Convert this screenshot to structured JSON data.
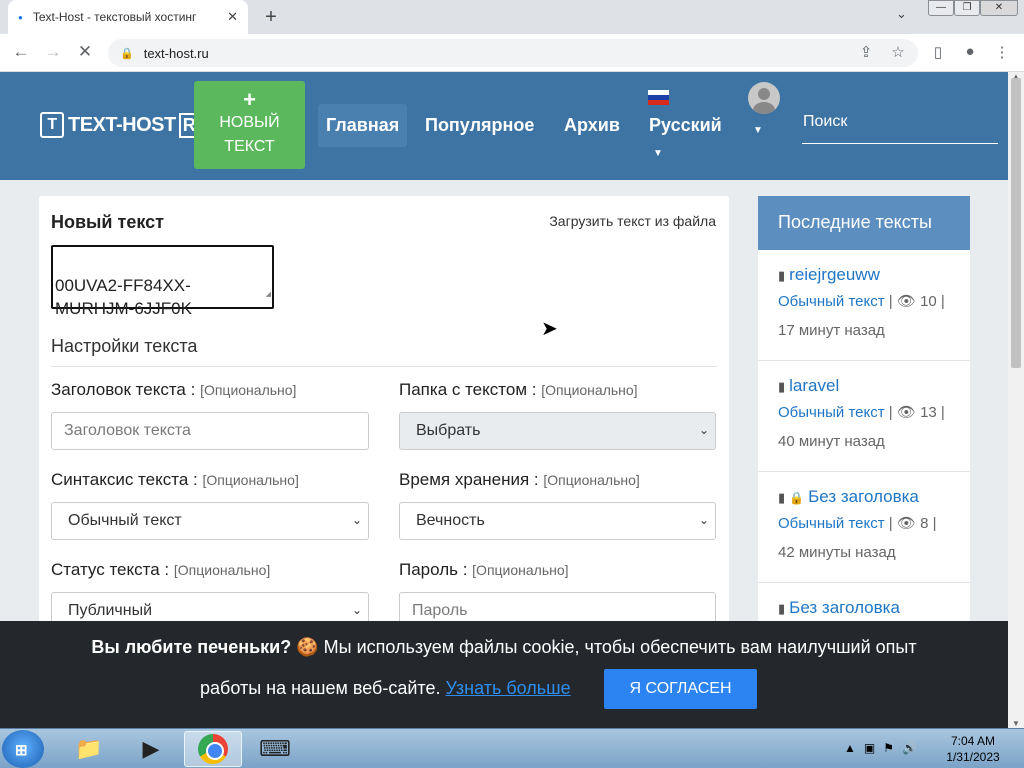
{
  "browser": {
    "tab_title": "Text-Host - текстовый хостинг",
    "tab_close": "✕",
    "new_tab": "+",
    "tab_menu": "⌄",
    "url": "text-host.ru",
    "window_controls": [
      "—",
      "❐",
      "✕"
    ]
  },
  "site": {
    "logo_mark": "T",
    "logo_text": "TEXT-HOST",
    "logo_ru": "RU",
    "new_text_plus": "+",
    "new_text_line1": "НОВЫЙ",
    "new_text_line2": "ТЕКСТ",
    "nav": [
      "Главная",
      "Популярное",
      "Архив",
      "Русский"
    ],
    "search_placeholder": "Поиск"
  },
  "form": {
    "title": "Новый текст",
    "upload_link": "Загрузить текст из файла",
    "text_value": "00UVA2-FF84XX-\nMURHJM-6JJF0K",
    "settings_title": "Настройки текста",
    "optional": "[Опционально]",
    "fields": {
      "title_label": "Заголовок текста :",
      "title_placeholder": "Заголовок текста",
      "folder_label": "Папка с текстом :",
      "folder_value": "Выбрать",
      "syntax_label": "Синтаксис текста :",
      "syntax_value": "Обычный текст",
      "expire_label": "Время хранения :",
      "expire_value": "Вечность",
      "status_label": "Статус текста :",
      "status_value": "Публичный",
      "password_label": "Пароль :",
      "password_placeholder": "Пароль"
    }
  },
  "sidebar": {
    "title": "Последние тексты",
    "items": [
      {
        "title": "reiejrgeuww",
        "type": "Обычный текст",
        "views": "10",
        "time": "17 минут назад",
        "locked": false
      },
      {
        "title": "laravel",
        "type": "Обычный текст",
        "views": "13",
        "time": "40 минут назад",
        "locked": false
      },
      {
        "title": "Без заголовка",
        "type": "Обычный текст",
        "views": "8",
        "time": "42 минуты назад",
        "locked": true
      },
      {
        "title": "Без заголовка",
        "type": "",
        "views": "",
        "time": "",
        "locked": false
      }
    ]
  },
  "cookie": {
    "question": "Вы любите печеньки?",
    "line1_rest": "🍪 Мы используем файлы cookie, чтобы обеспечить вам наилучший опыт",
    "line2": "работы на нашем веб-сайте.",
    "learn_more": "Узнать больше",
    "agree": "Я СОГЛАСЕН"
  },
  "taskbar": {
    "time": "7:04 AM",
    "date": "1/31/2023"
  },
  "colors": {
    "header": "#3d74a3",
    "new_button": "#5cb85c",
    "sidebar_head": "#5c8fc0",
    "link": "#1f76c5",
    "cookie_bg": "#24282c",
    "agree_button": "#2b84f1"
  }
}
